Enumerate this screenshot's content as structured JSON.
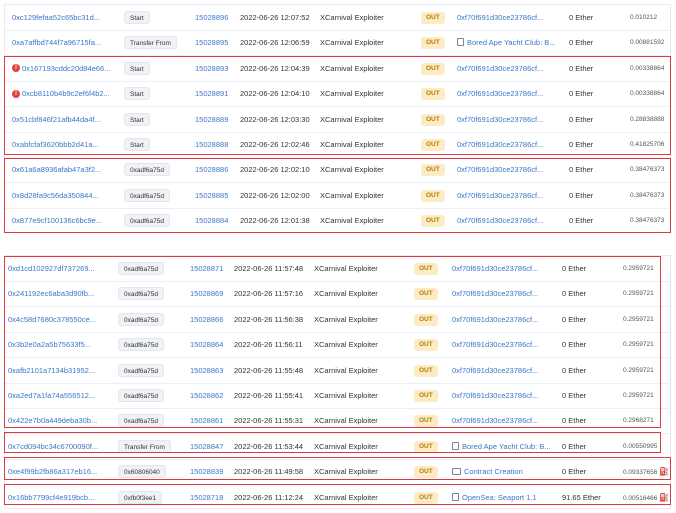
{
  "labels": {
    "out": "OUT"
  },
  "colors": {
    "highlight": "#d93b45",
    "link": "#3a77c8",
    "out_badge": "#fcebc4",
    "error": "#de4437"
  },
  "top_rows": [
    {
      "hash": "0xc129fefaa52c65bc31d...",
      "method": "Start",
      "block": "15028896",
      "age": "2022-06-26 12:07:52",
      "from": "XCarnival Exploiter",
      "to": "0xf70f691d30ce23786cf...",
      "value": "0 Ether",
      "fee": "0.010212",
      "error": false,
      "to_icon": ""
    },
    {
      "hash": "0xa7affbd744f7a96715fa...",
      "method": "Transfer From",
      "block": "15028895",
      "age": "2022-06-26 12:06:59",
      "from": "XCarnival Exploiter",
      "to": "Bored Ape Yacht Club: B...",
      "value": "0 Ether",
      "fee": "0.00881592",
      "error": false,
      "to_icon": "document-icon"
    },
    {
      "hash": "0x167193cddc20d84e66...",
      "method": "Start",
      "block": "15028893",
      "age": "2022-06-26 12:04:39",
      "from": "XCarnival Exploiter",
      "to": "0xf70f691d30ce23786cf...",
      "value": "0 Ether",
      "fee": "0.00338864",
      "error": true,
      "to_icon": ""
    },
    {
      "hash": "0xcb8110b4b9c2ef6f4b2...",
      "method": "Start",
      "block": "15028891",
      "age": "2022-06-26 12:04:10",
      "from": "XCarnival Exploiter",
      "to": "0xf70f691d30ce23786cf...",
      "value": "0 Ether",
      "fee": "0.00338864",
      "error": true,
      "to_icon": ""
    },
    {
      "hash": "0x51cbf846f21afb44da4f...",
      "method": "Start",
      "block": "15028889",
      "age": "2022-06-26 12:03:30",
      "from": "XCarnival Exploiter",
      "to": "0xf70f691d30ce23786cf...",
      "value": "0 Ether",
      "fee": "0.28838888",
      "error": false,
      "to_icon": ""
    },
    {
      "hash": "0xabfcfaf3620bbb2d41a...",
      "method": "Start",
      "block": "15028888",
      "age": "2022-06-26 12:02:46",
      "from": "XCarnival Exploiter",
      "to": "0xf70f691d30ce23786cf...",
      "value": "0 Ether",
      "fee": "0.41825706",
      "error": false,
      "to_icon": ""
    },
    {
      "hash": "0x61a6a8936afab47a3f2...",
      "method": "0xadf6a75d",
      "block": "15028886",
      "age": "2022-06-26 12:02:10",
      "from": "XCarnival Exploiter",
      "to": "0xf70f691d30ce23786cf...",
      "value": "0 Ether",
      "fee": "0.38476373",
      "error": false,
      "to_icon": ""
    },
    {
      "hash": "0x8d28fa9c56da350844...",
      "method": "0xadf6a75d",
      "block": "15028885",
      "age": "2022-06-26 12:02:00",
      "from": "XCarnival Exploiter",
      "to": "0xf70f691d30ce23786cf...",
      "value": "0 Ether",
      "fee": "0.38476373",
      "error": false,
      "to_icon": ""
    },
    {
      "hash": "0x877e9cf100136c6bc9e...",
      "method": "0xadf6a75d",
      "block": "15028884",
      "age": "2022-06-26 12:01:38",
      "from": "XCarnival Exploiter",
      "to": "0xf70f691d30ce23786cf...",
      "value": "0 Ether",
      "fee": "0.38476373",
      "error": false,
      "to_icon": ""
    }
  ],
  "bottom_rows": [
    {
      "hash": "0xd1cd102927df737269...",
      "method": "0xadf6a75d",
      "block": "15028871",
      "age": "2022-06-26 11:57:48",
      "from": "XCarnival Exploiter",
      "to": "0xf70f691d30ce23786cf...",
      "value": "0 Ether",
      "fee": "0.2959721",
      "to_icon": "",
      "gas": false
    },
    {
      "hash": "0x241192ec6aba3d90fb...",
      "method": "0xadf6a75d",
      "block": "15028869",
      "age": "2022-06-26 11:57:16",
      "from": "XCarnival Exploiter",
      "to": "0xf70f691d30ce23786cf...",
      "value": "0 Ether",
      "fee": "0.2959721",
      "to_icon": "",
      "gas": false
    },
    {
      "hash": "0x4c58d7680c378550ce...",
      "method": "0xadf6a75d",
      "block": "15028866",
      "age": "2022-06-26 11:56:38",
      "from": "XCarnival Exploiter",
      "to": "0xf70f691d30ce23786cf...",
      "value": "0 Ether",
      "fee": "0.2959721",
      "to_icon": "",
      "gas": false
    },
    {
      "hash": "0x3b2e0a2a5b75633f5...",
      "method": "0xadf6a75d",
      "block": "15028864",
      "age": "2022-06-26 11:56:11",
      "from": "XCarnival Exploiter",
      "to": "0xf70f691d30ce23786cf...",
      "value": "0 Ether",
      "fee": "0.2959721",
      "to_icon": "",
      "gas": false
    },
    {
      "hash": "0xafb2101a7134b31952...",
      "method": "0xadf6a75d",
      "block": "15028863",
      "age": "2022-06-26 11:55:48",
      "from": "XCarnival Exploiter",
      "to": "0xf70f691d30ce23786cf...",
      "value": "0 Ether",
      "fee": "0.2959721",
      "to_icon": "",
      "gas": false
    },
    {
      "hash": "0xa2ed7a1fa74a556512...",
      "method": "0xadf6a75d",
      "block": "15028862",
      "age": "2022-06-26 11:55:41",
      "from": "XCarnival Exploiter",
      "to": "0xf70f691d30ce23786cf...",
      "value": "0 Ether",
      "fee": "0.2959721",
      "to_icon": "",
      "gas": false
    },
    {
      "hash": "0x422e7b0a449deba30b...",
      "method": "0xadf6a75d",
      "block": "15028861",
      "age": "2022-06-26 11:55:31",
      "from": "XCarnival Exploiter",
      "to": "0xf70f691d30ce23786cf...",
      "value": "0 Ether",
      "fee": "0.2968271",
      "to_icon": "",
      "gas": false
    },
    {
      "hash": "0x7cd094bc34c6700090f...",
      "method": "Transfer From",
      "block": "15028847",
      "age": "2022-06-26 11:53:44",
      "from": "XCarnival Exploiter",
      "to": "Bored Ape Yacht Club: B...",
      "value": "0 Ether",
      "fee": "0.00550995",
      "to_icon": "document-icon",
      "gas": false
    },
    {
      "hash": "0xe4f99b2fb86a317eb16...",
      "method": "0x60806040",
      "block": "15028839",
      "age": "2022-06-26 11:49:58",
      "from": "XCarnival Exploiter",
      "to": "Contract Creation",
      "value": "0 Ether",
      "fee": "0.09337656",
      "to_icon": "contract-creation-icon",
      "gas": true
    },
    {
      "hash": "0x16bb7799cf4e919bcb...",
      "method": "0xfb0f3ee1",
      "block": "15028718",
      "age": "2022-06-26 11:12:24",
      "from": "XCarnival Exploiter",
      "to": "OpenSea: Seaport 1.1",
      "value": "91.65 Ether",
      "fee": "0.00516466",
      "to_icon": "document-icon",
      "gas": true
    }
  ]
}
